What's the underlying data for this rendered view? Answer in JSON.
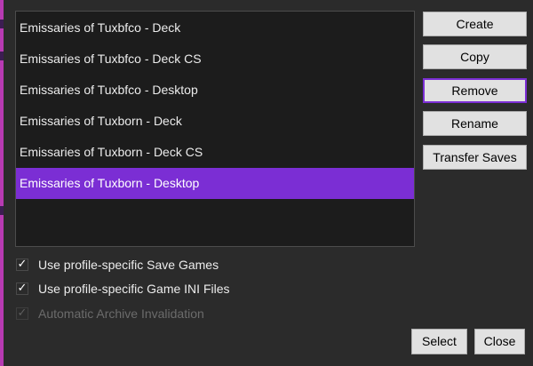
{
  "profiles": [
    {
      "label": "Emissaries of Tuxbfco - Deck",
      "selected": false
    },
    {
      "label": "Emissaries of Tuxbfco - Deck CS",
      "selected": false
    },
    {
      "label": "Emissaries of Tuxbfco - Desktop",
      "selected": false
    },
    {
      "label": "Emissaries of Tuxborn - Deck",
      "selected": false
    },
    {
      "label": "Emissaries of Tuxborn - Deck CS",
      "selected": false
    },
    {
      "label": "Emissaries of Tuxborn - Desktop",
      "selected": true
    }
  ],
  "actions": {
    "create_label": "Create",
    "copy_label": "Copy",
    "remove_label": "Remove",
    "rename_label": "Rename",
    "transfer_label": "Transfer Saves"
  },
  "options": {
    "save_games": {
      "label": "Use profile-specific Save Games",
      "checked": true,
      "enabled": true
    },
    "ini_files": {
      "label": "Use profile-specific Game INI Files",
      "checked": true,
      "enabled": true
    },
    "archive_invalidation": {
      "label": "Automatic Archive Invalidation",
      "checked": true,
      "enabled": false
    }
  },
  "footer": {
    "select_label": "Select",
    "close_label": "Close"
  },
  "icons": {
    "checkmark": "checkmark-icon"
  },
  "colors": {
    "accent": "#7b2ed4",
    "background": "#2b2b2b",
    "list_background": "#1c1c1c"
  }
}
